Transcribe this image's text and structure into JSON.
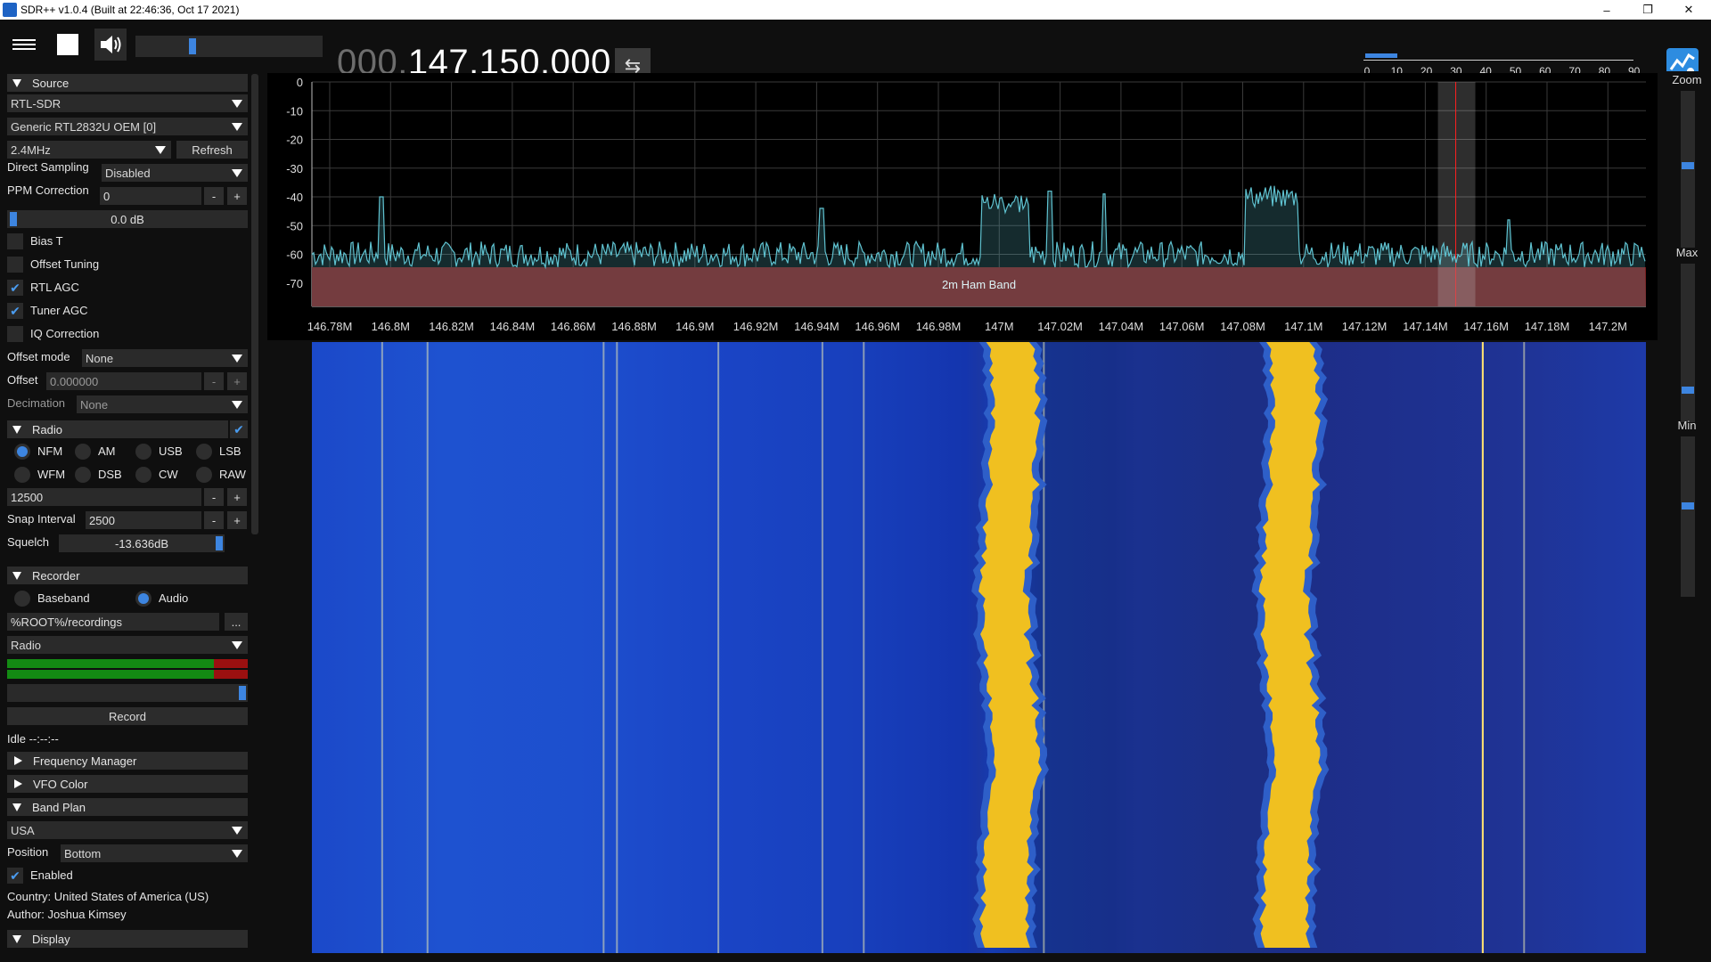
{
  "window": {
    "title": "SDR++ v1.0.4 (Built at 22:46:36, Oct 17 2021)",
    "minimize": "–",
    "restore": "❐",
    "close": "✕"
  },
  "toolbar": {
    "frequency_dim": "000.",
    "frequency_main": "147.150.000",
    "swap_icon": "⇆",
    "snr_ticks": [
      "0",
      "10",
      "20",
      "30",
      "40",
      "50",
      "60",
      "70",
      "80",
      "90"
    ]
  },
  "source": {
    "header": "Source",
    "device_type": "RTL-SDR",
    "device": "Generic RTL2832U OEM [0]",
    "samplerate": "2.4MHz",
    "refresh": "Refresh",
    "direct_sampling_label": "Direct Sampling",
    "direct_sampling_value": "Disabled",
    "ppm_label": "PPM Correction",
    "ppm_value": "0",
    "gain_value": "0.0 dB",
    "bias_t": "Bias T",
    "offset_tuning": "Offset Tuning",
    "rtl_agc": "RTL AGC",
    "tuner_agc": "Tuner AGC",
    "iq_correction": "IQ Correction",
    "offset_mode_label": "Offset mode",
    "offset_mode_value": "None",
    "offset_label": "Offset",
    "offset_value": "0.000000",
    "decimation_label": "Decimation",
    "decimation_value": "None",
    "minus": "-",
    "plus": "+"
  },
  "radio": {
    "header": "Radio",
    "modes": [
      "NFM",
      "AM",
      "USB",
      "LSB",
      "WFM",
      "DSB",
      "CW",
      "RAW"
    ],
    "selected_mode": "NFM",
    "bandwidth": "12500",
    "snap_label": "Snap Interval",
    "snap_value": "2500",
    "squelch_label": "Squelch",
    "squelch_value": "-13.636dB"
  },
  "recorder": {
    "header": "Recorder",
    "baseband": "Baseband",
    "audio": "Audio",
    "path": "%ROOT%/recordings",
    "browse": "...",
    "stream": "Radio",
    "record": "Record",
    "status": "Idle --:--:--"
  },
  "collapsed": {
    "frequency_manager": "Frequency Manager",
    "vfo_color": "VFO Color"
  },
  "band_plan": {
    "header": "Band Plan",
    "plan": "USA",
    "position_label": "Position",
    "position_value": "Bottom",
    "enabled": "Enabled",
    "country": "Country: United States of America (US)",
    "author": "Author: Joshua Kimsey"
  },
  "display": {
    "header": "Display"
  },
  "right": {
    "zoom": "Zoom",
    "max": "Max",
    "min": "Min"
  },
  "spectrum": {
    "y_ticks": [
      "0",
      "-10",
      "-20",
      "-30",
      "-40",
      "-50",
      "-60",
      "-70"
    ],
    "x_ticks": [
      "146.78M",
      "146.8M",
      "146.82M",
      "146.84M",
      "146.86M",
      "146.88M",
      "146.9M",
      "146.92M",
      "146.94M",
      "146.96M",
      "146.98M",
      "147M",
      "147.02M",
      "147.04M",
      "147.06M",
      "147.08M",
      "147.1M",
      "147.12M",
      "147.14M",
      "147.16M",
      "147.18M",
      "147.2M"
    ],
    "band_label": "2m Ham Band",
    "colors": {
      "trace": "#5fc2d0",
      "band": "#7a1616",
      "vfo": "#ff2020",
      "accent": "#3d85e0"
    }
  }
}
